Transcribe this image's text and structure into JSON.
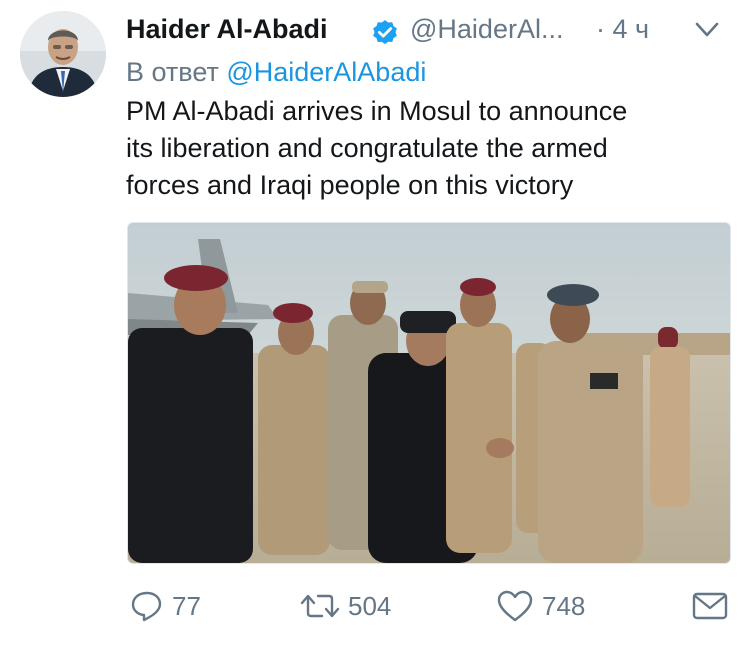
{
  "tweet": {
    "author_name": "Haider Al-Abadi",
    "author_handle": "@HaiderAl...",
    "time_separator": "·",
    "time": "4 ч",
    "reply_prefix": "В ответ",
    "reply_to": "@HaiderAlAbadi",
    "text_lines": [
      "PM Al-Abadi arrives in Mosul to announce",
      "its liberation and congratulate the armed",
      "forces and Iraqi people on this victory"
    ]
  },
  "actions": {
    "reply_count": "77",
    "retweet_count": "504",
    "like_count": "748"
  },
  "icons": {
    "verified": "verified-badge-icon",
    "menu": "chevron-down-icon",
    "reply": "reply-icon",
    "retweet": "retweet-icon",
    "like": "heart-icon",
    "message": "envelope-icon"
  },
  "colors": {
    "text": "#14171a",
    "secondary": "#657786",
    "link": "#1b95e0",
    "verified": "#1da1f2"
  }
}
